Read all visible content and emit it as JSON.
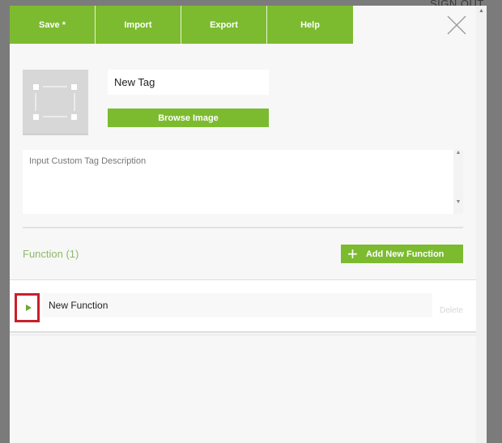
{
  "background": {
    "signout": "SIGN OUT"
  },
  "menu": {
    "items": [
      "Save *",
      "Import",
      "Export",
      "Help"
    ]
  },
  "tag": {
    "name": "New Tag",
    "browse_label": "Browse Image",
    "description_placeholder": "Input Custom Tag Description"
  },
  "functions": {
    "header": "Function (1)",
    "add_label": "Add New Function",
    "items": [
      {
        "name": "New Function",
        "delete_label": "Delete"
      }
    ]
  },
  "colors": {
    "accent": "#7cbb2f",
    "highlight": "#c8202a"
  }
}
